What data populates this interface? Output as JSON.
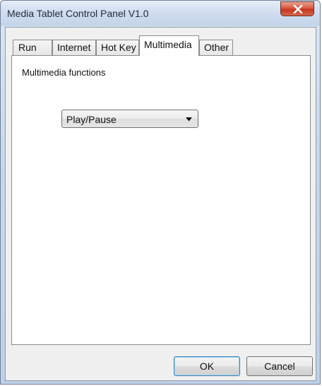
{
  "window": {
    "title": "Media Tablet Control Panel V1.0"
  },
  "tabs": [
    {
      "label": "Run"
    },
    {
      "label": "Internet"
    },
    {
      "label": "Hot Key"
    },
    {
      "label": "Multimedia",
      "active": true
    },
    {
      "label": "Other"
    }
  ],
  "multimedia": {
    "section_label": "Multimedia functions",
    "selected_function": "Play/Pause"
  },
  "buttons": {
    "ok_label": "OK",
    "cancel_label": "Cancel"
  },
  "colors": {
    "close_button": "#d9573f",
    "ok_focus_border": "#3c7fb1"
  },
  "icons": {
    "close": "close-icon",
    "dropdown": "chevron-down-icon"
  }
}
